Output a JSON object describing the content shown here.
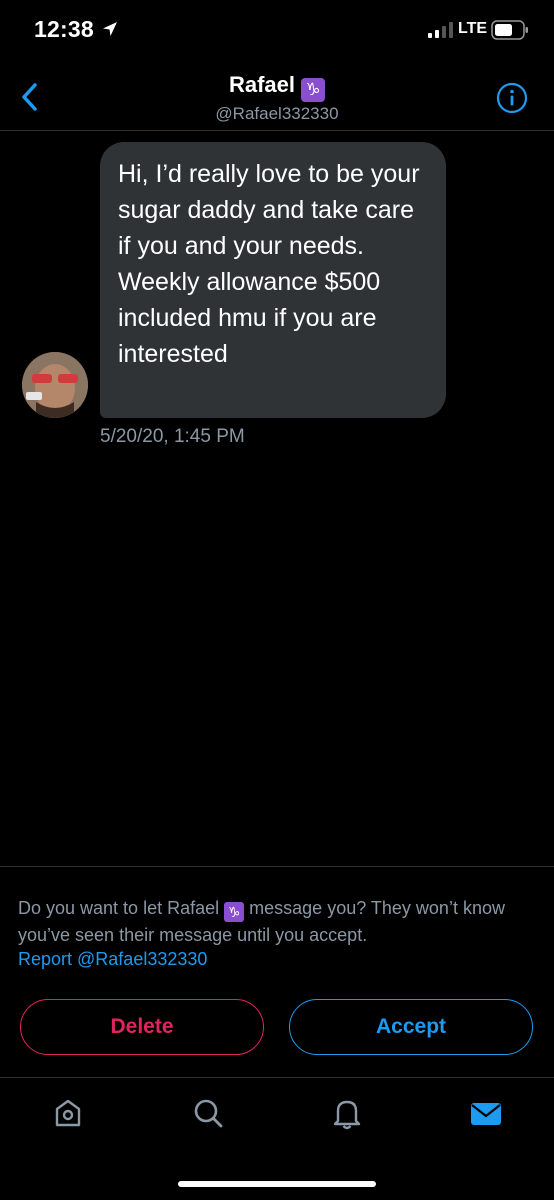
{
  "status_bar": {
    "time": "12:38",
    "network": "LTE",
    "icons": [
      "location-arrow-icon",
      "signal-icon",
      "battery-icon"
    ]
  },
  "header": {
    "name": "Rafael",
    "zodiac": "♑",
    "handle": "@Rafael332330",
    "back_icon": "chevron-left-icon",
    "info_icon": "info-icon"
  },
  "conversation": {
    "message": "Hi, I’d really love to be your sugar daddy and take care if you and your needs. Weekly allowance $500 included hmu if you are interested",
    "timestamp": "5/20/20, 1:45 PM"
  },
  "request_panel": {
    "prompt_before": "Do you want to let Rafael",
    "zodiac": "♑",
    "prompt_after": "message you? They won’t know you’ve seen their message until you accept.",
    "report_label": "Report @Rafael332330",
    "delete_label": "Delete",
    "accept_label": "Accept"
  },
  "tab_bar": {
    "tabs": [
      "home-icon",
      "search-icon",
      "notifications-icon",
      "messages-icon"
    ],
    "active": "messages-icon"
  },
  "colors": {
    "accent": "#1d9bf0",
    "danger": "#e0245e",
    "bubble": "#2f3336",
    "muted": "#8b98a5",
    "zodiac": "#8a4fd1"
  }
}
